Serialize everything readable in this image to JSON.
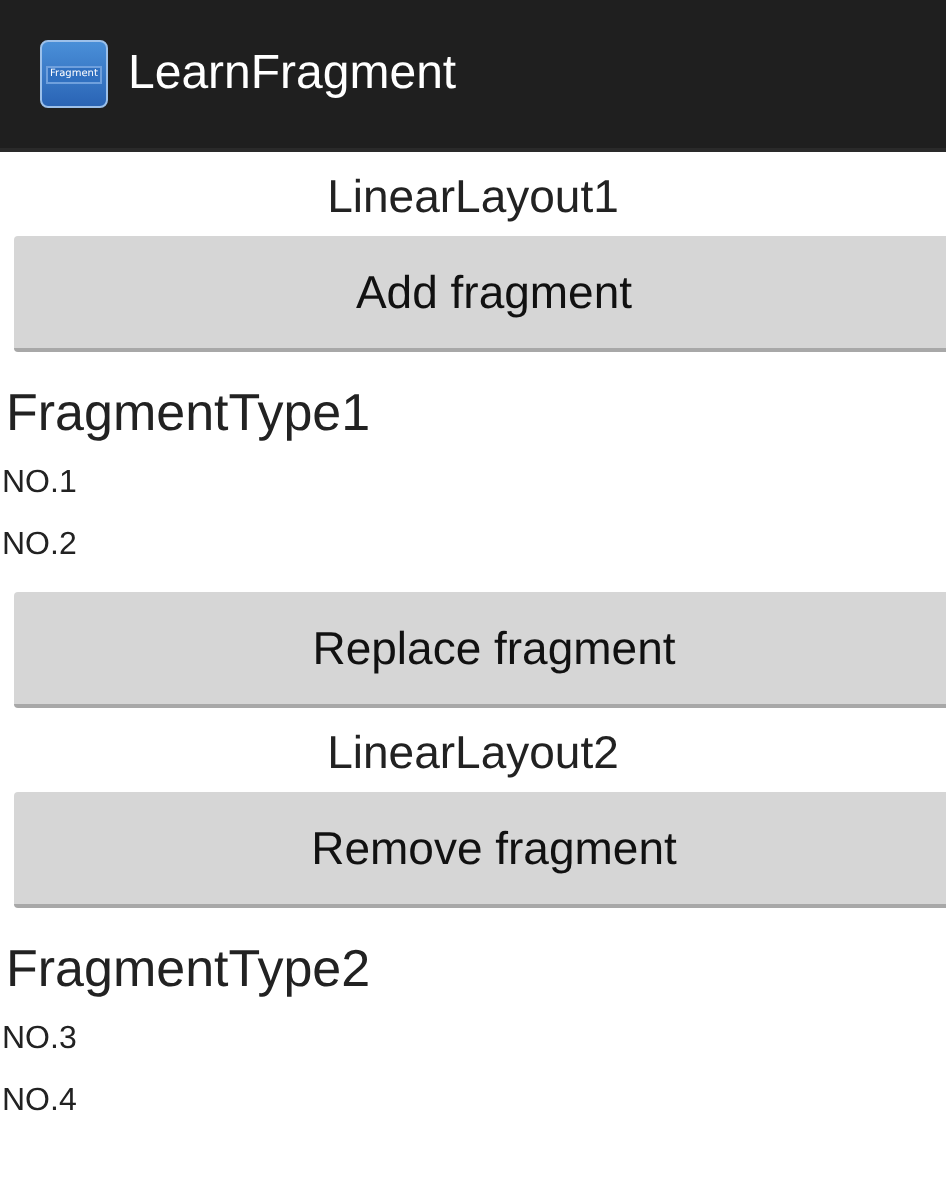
{
  "action_bar": {
    "icon_label": "Fragment",
    "title": "LearnFragment"
  },
  "items": [
    {
      "kind": "heading",
      "text": "LinearLayout1"
    },
    {
      "kind": "button",
      "text": "Add fragment"
    },
    {
      "kind": "fragment_title",
      "text": "FragmentType1"
    },
    {
      "kind": "line",
      "text": "NO.1"
    },
    {
      "kind": "line",
      "text": "NO.2"
    },
    {
      "kind": "button",
      "text": "Replace fragment"
    },
    {
      "kind": "heading",
      "text": "LinearLayout2"
    },
    {
      "kind": "button",
      "text": "Remove fragment"
    },
    {
      "kind": "fragment_title",
      "text": "FragmentType2"
    },
    {
      "kind": "line",
      "text": "NO.3"
    },
    {
      "kind": "line",
      "text": "NO.4"
    }
  ]
}
